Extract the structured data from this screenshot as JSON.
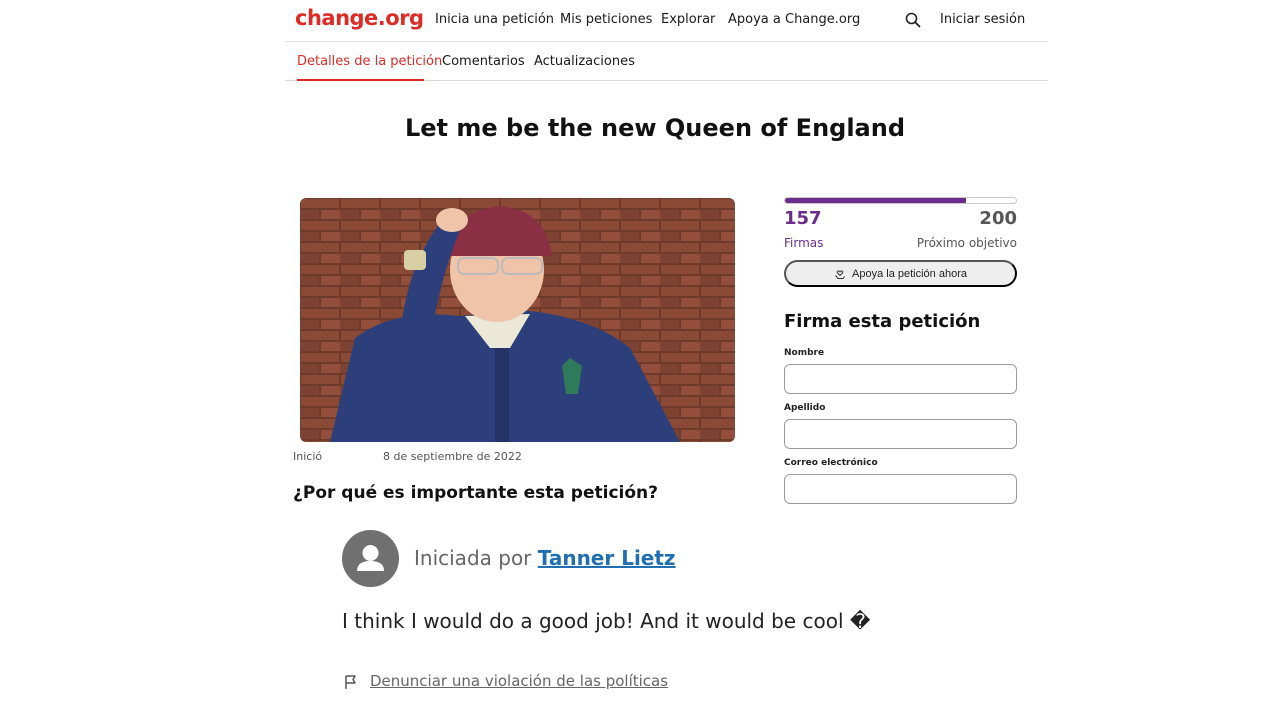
{
  "header": {
    "logo": "change.org",
    "nav": [
      "Inicia una petición",
      "Mis peticiones",
      "Explorar",
      "Apoya a Change.org"
    ],
    "login": "Iniciar sesión"
  },
  "tabs": [
    "Detalles de la petición",
    "Comentarios",
    "Actualizaciones"
  ],
  "petition": {
    "title": "Let me be the new Queen of England",
    "started_label": "Inició",
    "started_date": "8 de septiembre de 2022",
    "why_heading": "¿Por qué es importante esta petición?",
    "started_by_prefix": "Iniciada por",
    "author": "Tanner Lietz",
    "body": "I think I would do a good job! And it would be cool �",
    "report_link": "Denunciar una violación de las políticas"
  },
  "signatures": {
    "count": "157",
    "goal": "200",
    "progress": 0.785,
    "count_label": "Firmas",
    "goal_label": "Próximo objetivo",
    "support_button": "Apoya la petición ahora"
  },
  "sign_form": {
    "title": "Firma esta petición",
    "first_name_label": "Nombre",
    "last_name_label": "Apellido",
    "email_label": "Correo electrónico"
  },
  "colors": {
    "brand": "#dd2b26",
    "progress": "#6b2d8b",
    "link": "#1f6fb2"
  },
  "icons": [
    "search-icon",
    "hand-heart-icon",
    "person-icon",
    "flag-icon"
  ]
}
